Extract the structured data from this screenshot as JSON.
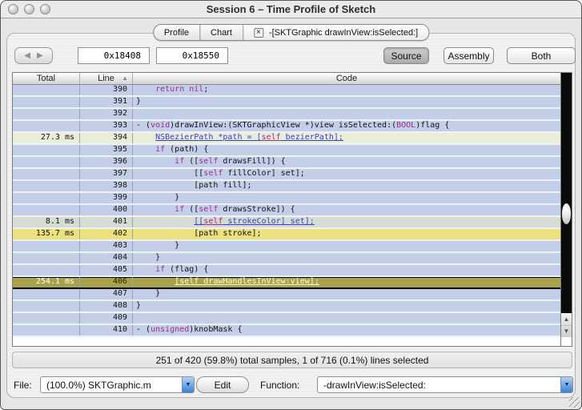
{
  "window": {
    "title": "Session 6 – Time Profile of Sketch"
  },
  "icons": {
    "close_tab": "×",
    "sort_asc": "▲",
    "back": "◀",
    "forward": "▶",
    "dropdown": "▼",
    "scroll_up": "▲",
    "scroll_down": "▼"
  },
  "tab_bar": {
    "tabs": [
      {
        "label": "Profile"
      },
      {
        "label": "Chart"
      },
      {
        "label": "-[SKTGraphic drawInView:isSelected:]",
        "closable": true
      }
    ]
  },
  "toolbar": {
    "address_start": "0x18408",
    "address_end": "0x18550",
    "view_modes": [
      {
        "label": "Source",
        "active": true
      },
      {
        "label": "Assembly",
        "active": false
      },
      {
        "label": "Both",
        "active": false
      }
    ]
  },
  "code_table": {
    "columns": [
      "Total",
      "Line",
      "Code"
    ],
    "sort_column": "Line",
    "rows": [
      {
        "total": "",
        "line": "390",
        "bg": "blue",
        "code": [
          [
            "    ",
            "p"
          ],
          [
            "return",
            "k"
          ],
          [
            " ",
            "p"
          ],
          [
            "nil",
            "k"
          ],
          [
            ";",
            "p"
          ]
        ]
      },
      {
        "total": "",
        "line": "391",
        "bg": "blue",
        "code": [
          [
            "}",
            "p"
          ]
        ]
      },
      {
        "total": "",
        "line": "392",
        "bg": "blue",
        "code": []
      },
      {
        "total": "",
        "line": "393",
        "bg": "blue",
        "code": [
          [
            "- (",
            "p"
          ],
          [
            "void",
            "k"
          ],
          [
            ")drawInView:(SKTGraphicView *)view isSelected:(",
            "p"
          ],
          [
            "BOOL",
            "k"
          ],
          [
            ")flag {",
            "p"
          ]
        ]
      },
      {
        "total": "27.3 ms",
        "line": "394",
        "bg": "green",
        "code": [
          [
            "    ",
            "p"
          ],
          [
            "NSBezierPath *path = [",
            "l"
          ],
          [
            "self",
            "lk"
          ],
          [
            " bezierPath",
            "l"
          ],
          [
            "];",
            "l"
          ]
        ]
      },
      {
        "total": "",
        "line": "395",
        "bg": "blue",
        "code": [
          [
            "    ",
            "p"
          ],
          [
            "if",
            "k"
          ],
          [
            " (path) {",
            "p"
          ]
        ]
      },
      {
        "total": "",
        "line": "396",
        "bg": "blue",
        "code": [
          [
            "        ",
            "p"
          ],
          [
            "if",
            "k"
          ],
          [
            " ([",
            "p"
          ],
          [
            "self",
            "k"
          ],
          [
            " drawsFill]) {",
            "p"
          ]
        ]
      },
      {
        "total": "",
        "line": "397",
        "bg": "blue",
        "code": [
          [
            "            [[",
            "p"
          ],
          [
            "self",
            "k"
          ],
          [
            " fillColor] set];",
            "p"
          ]
        ]
      },
      {
        "total": "",
        "line": "398",
        "bg": "blue",
        "code": [
          [
            "            [path fill];",
            "p"
          ]
        ]
      },
      {
        "total": "",
        "line": "399",
        "bg": "blue",
        "code": [
          [
            "        }",
            "p"
          ]
        ]
      },
      {
        "total": "",
        "line": "400",
        "bg": "blue",
        "code": [
          [
            "        ",
            "p"
          ],
          [
            "if",
            "k"
          ],
          [
            " ([",
            "p"
          ],
          [
            "self",
            "k"
          ],
          [
            " drawsStroke]) {",
            "p"
          ]
        ]
      },
      {
        "total": "8.1 ms",
        "line": "401",
        "bg": "graygreen",
        "code": [
          [
            "            ",
            "p"
          ],
          [
            "[[",
            "l"
          ],
          [
            "self",
            "lk"
          ],
          [
            " strokeColor",
            "l"
          ],
          [
            "] set];",
            "l"
          ]
        ]
      },
      {
        "total": "135.7 ms",
        "line": "402",
        "bg": "yellow",
        "code": [
          [
            "            [path stroke];",
            "p"
          ]
        ]
      },
      {
        "total": "",
        "line": "403",
        "bg": "blue",
        "code": [
          [
            "        }",
            "p"
          ]
        ]
      },
      {
        "total": "",
        "line": "404",
        "bg": "blue",
        "code": [
          [
            "    }",
            "p"
          ]
        ]
      },
      {
        "total": "",
        "line": "405",
        "bg": "blue",
        "code": [
          [
            "    ",
            "p"
          ],
          [
            "if",
            "k"
          ],
          [
            " (flag) {",
            "p"
          ]
        ]
      },
      {
        "total": "254.1 ms",
        "line": "406",
        "bg": "selected",
        "code": [
          [
            "        ",
            "p"
          ],
          [
            "[self drawHandlesInView:view];",
            "sl"
          ]
        ]
      },
      {
        "total": "",
        "line": "407",
        "bg": "blue",
        "code": [
          [
            "    }",
            "p"
          ]
        ]
      },
      {
        "total": "",
        "line": "408",
        "bg": "blue",
        "code": [
          [
            "}",
            "p"
          ]
        ]
      },
      {
        "total": "",
        "line": "409",
        "bg": "blue",
        "code": []
      },
      {
        "total": "",
        "line": "410",
        "bg": "blue",
        "code": [
          [
            "- (",
            "p"
          ],
          [
            "unsigned",
            "k"
          ],
          [
            ")knobMask {",
            "p"
          ]
        ]
      }
    ]
  },
  "status_bar": {
    "text": "251 of 420 (59.8%) total samples, 1 of 716 (0.1%) lines selected"
  },
  "footer": {
    "file_label": "File:",
    "file_value": "(100.0%) SKTGraphic.m",
    "edit_button": "Edit",
    "function_label": "Function:",
    "function_value": "-drawInView:isSelected:"
  }
}
